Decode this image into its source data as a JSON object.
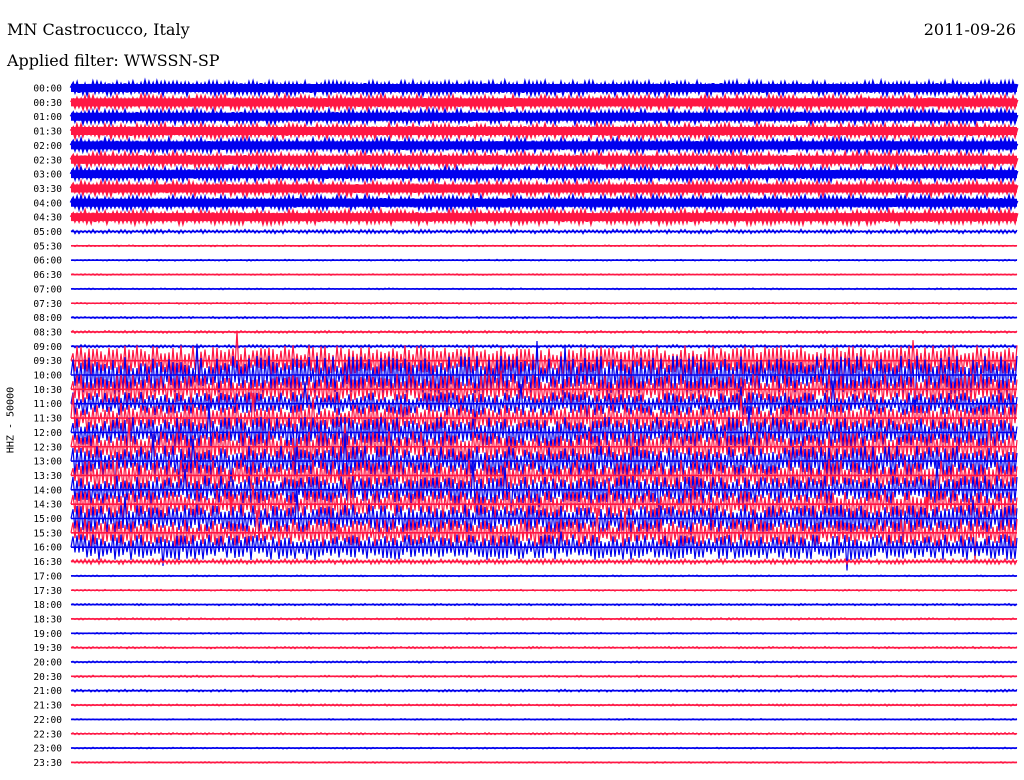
{
  "header": {
    "station": "MN Castrocucco, Italy",
    "date": "2011-09-26",
    "filter": "Applied filter: WWSSN-SP",
    "channel": "HHZ - 50000"
  },
  "colors": {
    "even": "#0000ee",
    "odd": "#ff1744"
  },
  "chart_data": {
    "type": "line",
    "plot_kind": "helicorder",
    "rows": [
      "00:00",
      "00:30",
      "01:00",
      "01:30",
      "02:00",
      "02:30",
      "03:00",
      "03:30",
      "04:00",
      "04:30",
      "05:00",
      "05:30",
      "06:00",
      "06:30",
      "07:00",
      "07:30",
      "08:00",
      "08:30",
      "09:00",
      "09:30",
      "10:00",
      "10:30",
      "11:00",
      "11:30",
      "12:00",
      "12:30",
      "13:00",
      "13:30",
      "14:00",
      "14:30",
      "15:00",
      "15:30",
      "16:00",
      "16:30",
      "17:00",
      "17:30",
      "18:00",
      "18:30",
      "19:00",
      "19:30",
      "20:00",
      "20:30",
      "21:00",
      "21:30",
      "22:00",
      "22:30",
      "23:00",
      "23:30"
    ],
    "amplitude": [
      0.18,
      0.18,
      0.18,
      0.18,
      0.18,
      0.18,
      0.18,
      0.18,
      0.18,
      0.18,
      0.08,
      0.03,
      0.03,
      0.03,
      0.03,
      0.03,
      0.04,
      0.05,
      0.06,
      0.6,
      0.75,
      0.6,
      0.45,
      0.55,
      0.6,
      0.6,
      0.6,
      0.6,
      0.55,
      0.55,
      0.55,
      0.55,
      0.5,
      0.1,
      0.03,
      0.03,
      0.04,
      0.04,
      0.03,
      0.04,
      0.04,
      0.04,
      0.05,
      0.04,
      0.03,
      0.04,
      0.03,
      0.03
    ],
    "grid": false
  }
}
